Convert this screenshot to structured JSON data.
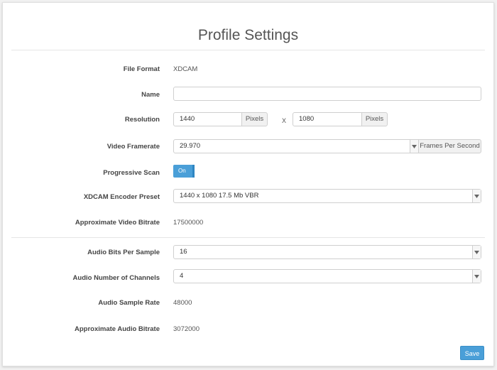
{
  "page": {
    "title": "Profile Settings"
  },
  "fields": {
    "file_format": {
      "label": "File Format",
      "value": "XDCAM"
    },
    "name": {
      "label": "Name",
      "value": ""
    },
    "resolution": {
      "label": "Resolution",
      "width": "1440",
      "width_unit": "Pixels",
      "separator": "X",
      "height": "1080",
      "height_unit": "Pixels"
    },
    "video_framerate": {
      "label": "Video Framerate",
      "value": "29.970",
      "unit": "Frames Per Second"
    },
    "progressive_scan": {
      "label": "Progressive Scan",
      "state": "On"
    },
    "encoder_preset": {
      "label": "XDCAM Encoder Preset",
      "value": "1440 x 1080 17.5 Mb VBR"
    },
    "video_bitrate": {
      "label": "Approximate Video Bitrate",
      "value": "17500000"
    },
    "audio_bits": {
      "label": "Audio Bits Per Sample",
      "value": "16"
    },
    "audio_channels": {
      "label": "Audio Number of Channels",
      "value": "4"
    },
    "audio_sample_rate": {
      "label": "Audio Sample Rate",
      "value": "48000"
    },
    "audio_bitrate": {
      "label": "Approximate Audio Bitrate",
      "value": "3072000"
    }
  },
  "actions": {
    "save_label": "Save"
  },
  "colors": {
    "accent": "#4a9fd8"
  }
}
